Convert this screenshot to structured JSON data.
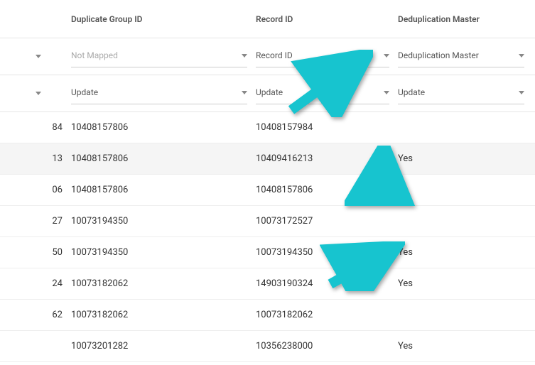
{
  "columns": {
    "dup_group": {
      "header": "Duplicate Group ID",
      "mapping": "Not Mapped",
      "action": "Update"
    },
    "record_id": {
      "header": "Record ID",
      "mapping": "Record ID",
      "action": "Update"
    },
    "dedup_master": {
      "header": "Deduplication Master",
      "mapping": "Deduplication Master",
      "action": "Update"
    }
  },
  "rows": [
    {
      "partial": "84",
      "dup_group": "10408157806",
      "record_id": "10408157984",
      "dedup": "",
      "hl": false
    },
    {
      "partial": "13",
      "dup_group": "10408157806",
      "record_id": "10409416213",
      "dedup": "Yes",
      "hl": true
    },
    {
      "partial": "06",
      "dup_group": "10408157806",
      "record_id": "10408157806",
      "dedup": "",
      "hl": false
    },
    {
      "partial": "27",
      "dup_group": "10073194350",
      "record_id": "10073172527",
      "dedup": "",
      "hl": false
    },
    {
      "partial": "50",
      "dup_group": "10073194350",
      "record_id": "10073194350",
      "dedup": "Yes",
      "hl": false
    },
    {
      "partial": "24",
      "dup_group": "10073182062",
      "record_id": "14903190324",
      "dedup": "Yes",
      "hl": false
    },
    {
      "partial": "62",
      "dup_group": "10073182062",
      "record_id": "10073182062",
      "dedup": "",
      "hl": false
    },
    {
      "partial": "",
      "dup_group": "10073201282",
      "record_id": "10356238000",
      "dedup": "Yes",
      "hl": false
    }
  ]
}
